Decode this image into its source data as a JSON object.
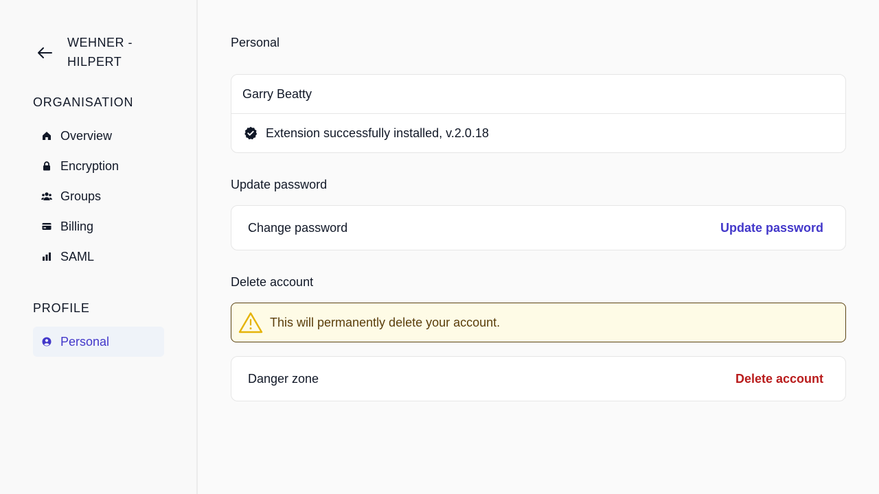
{
  "sidebar": {
    "org_name": "WEHNER - HILPERT",
    "organisation_label": "ORGANISATION",
    "organisation_items": [
      {
        "label": "Overview",
        "icon": "home-icon"
      },
      {
        "label": "Encryption",
        "icon": "lock-icon"
      },
      {
        "label": "Groups",
        "icon": "users-icon"
      },
      {
        "label": "Billing",
        "icon": "credit-card-icon"
      },
      {
        "label": "SAML",
        "icon": "bar-chart-icon"
      }
    ],
    "profile_label": "PROFILE",
    "profile_items": [
      {
        "label": "Personal",
        "icon": "user-circle-icon",
        "active": true
      }
    ]
  },
  "main": {
    "personal": {
      "heading": "Personal",
      "name": "Garry Beatty",
      "status": "Extension successfully installed, v.2.0.18"
    },
    "password": {
      "heading": "Update password",
      "row_label": "Change password",
      "action": "Update password"
    },
    "delete": {
      "heading": "Delete account",
      "warning": "This will permanently delete your account.",
      "row_label": "Danger zone",
      "action": "Delete account"
    }
  },
  "colors": {
    "accent": "#4338ca",
    "danger": "#b91c1c",
    "warning_bg": "#fefbe6",
    "warning_icon": "#e5b308"
  }
}
